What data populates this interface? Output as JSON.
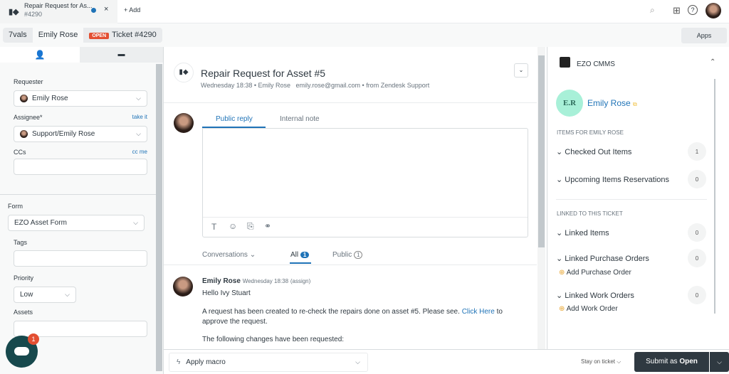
{
  "tabs": [
    {
      "title": "Repair Request for As...",
      "subtitle": "#4290"
    }
  ],
  "add_tab": "+ Add",
  "breadcrumb": {
    "org": "7vals",
    "user": "Emily Rose",
    "status": "OPEN",
    "ticket": "Ticket #4290"
  },
  "apps_label": "Apps",
  "left": {
    "requester_label": "Requester",
    "requester": "Emily Rose",
    "assignee_label": "Assignee*",
    "take_it": "take it",
    "assignee": "Support/Emily Rose",
    "ccs_label": "CCs",
    "cc_me": "cc me",
    "form_label": "Form",
    "form": "EZO Asset Form",
    "tags_label": "Tags",
    "priority_label": "Priority",
    "priority": "Low",
    "assets_label": "Assets",
    "chat_badge": "1"
  },
  "ticket": {
    "title": "Repair Request for Asset #5",
    "meta": "Wednesday 18:38 • Emily Rose   emily.rose@gmail.com • from Zendesk Support"
  },
  "reply": {
    "tab_public": "Public reply",
    "tab_internal": "Internal note"
  },
  "filters": {
    "conversations": "Conversations",
    "all": "All",
    "all_count": "1",
    "public": "Public",
    "public_count": "1"
  },
  "message": {
    "author": "Emily Rose",
    "time": "Wednesday 18:38",
    "tag": "(assign)",
    "greeting": "Hello Ivy Stuart",
    "body_1": "A request has been created to re-check the repairs done on asset #5. Please see. ",
    "link": "Click Here",
    "body_2": " to approve the request.",
    "body_3": "The following changes have been requested:"
  },
  "footer": {
    "macro": "Apply macro",
    "stay": "Stay on ticket",
    "submit_prefix": "Submit as ",
    "submit_status": "Open"
  },
  "app": {
    "name": "EZO CMMS",
    "initials": "E.R",
    "user": "Emily Rose",
    "items_header": "ITEMS FOR EMILY ROSE",
    "items": [
      {
        "label": "Checked Out Items",
        "count": "1"
      },
      {
        "label": "Upcoming Items Reservations",
        "count": "0"
      }
    ],
    "linked_header": "LINKED TO THIS TICKET",
    "linked": [
      {
        "label": "Linked Items",
        "count": "0"
      },
      {
        "label": "Linked Purchase Orders",
        "count": "0",
        "action": "Add Purchase Order"
      },
      {
        "label": "Linked Work Orders",
        "count": "0",
        "action": "Add Work Order"
      }
    ]
  },
  "colors": {
    "accent": "#1f73b7",
    "open": "#e34f32",
    "submit": "#2f3941",
    "avatar_er": "#a8f0d8"
  }
}
